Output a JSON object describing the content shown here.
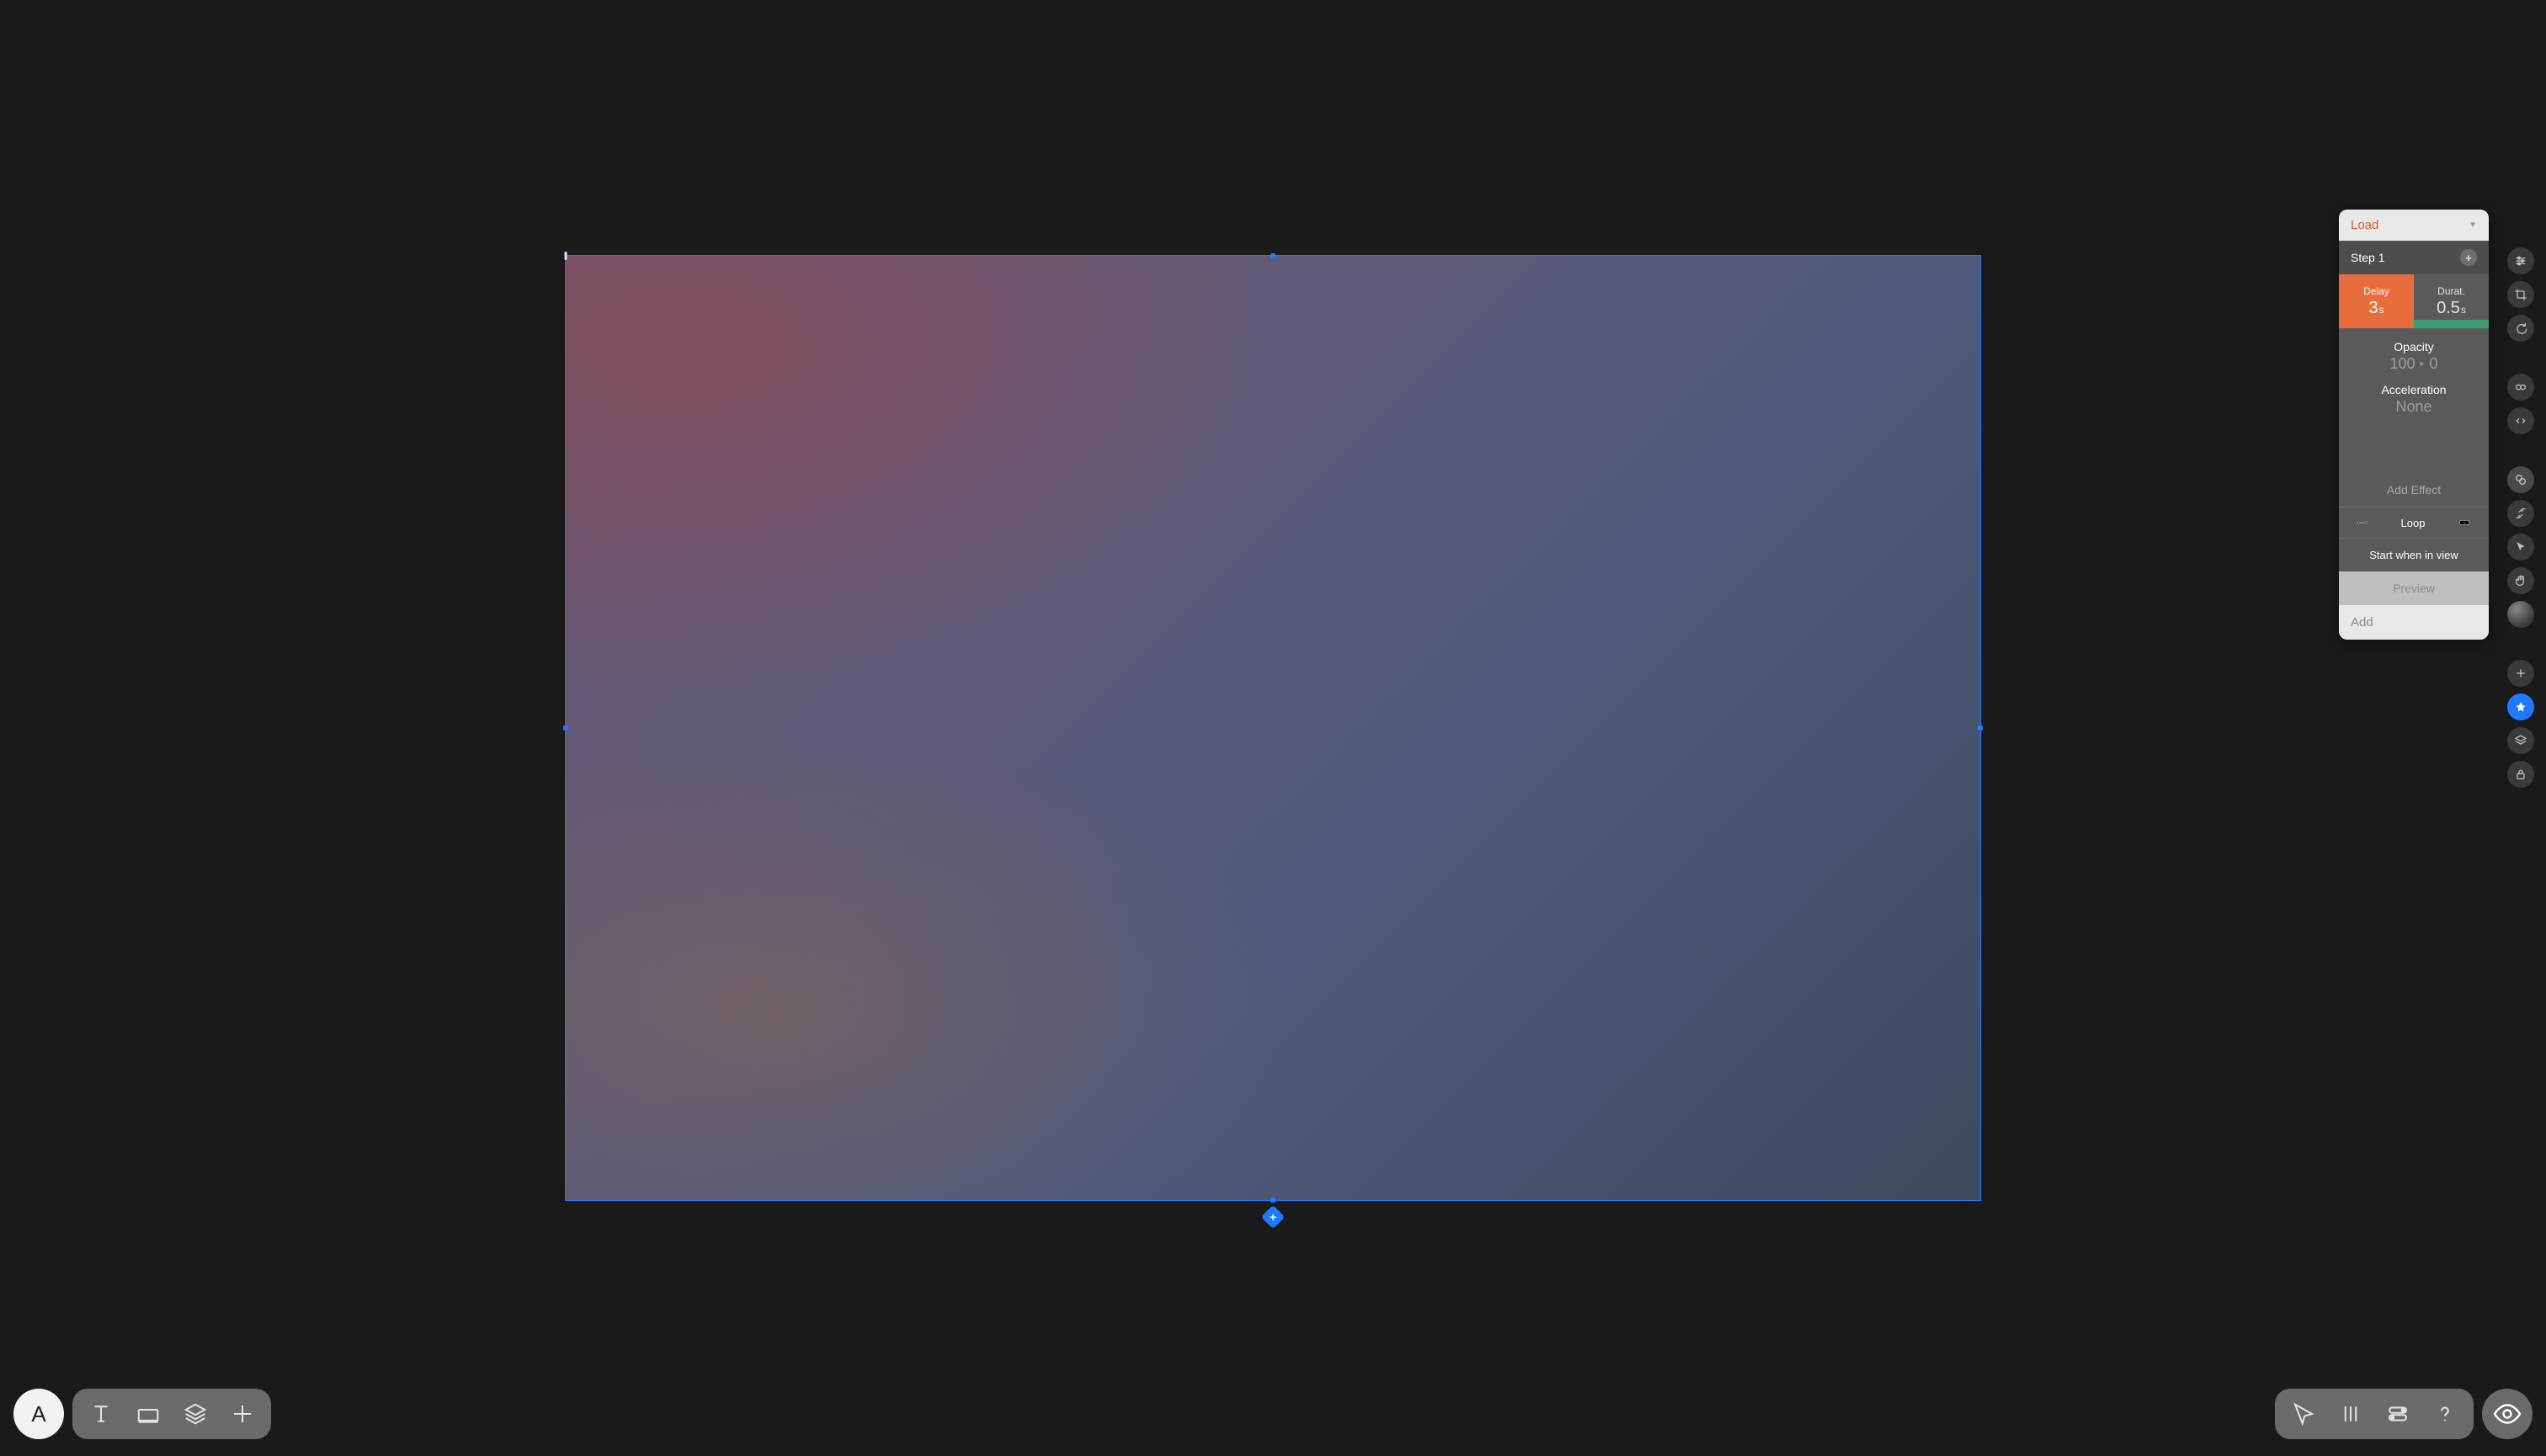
{
  "avatar_letter": "A",
  "animation_panel": {
    "trigger_label": "Load",
    "step_label": "Step 1",
    "delay": {
      "label": "Delay",
      "value": "3",
      "unit": "s"
    },
    "duration": {
      "label": "Durat.",
      "value": "0.5",
      "unit": "s"
    },
    "opacity": {
      "label": "Opacity",
      "from": "100",
      "to": "0"
    },
    "acceleration": {
      "label": "Acceleration",
      "value": "None"
    },
    "add_effect_label": "Add Effect",
    "loop_label": "Loop",
    "start_in_view_label": "Start when in view",
    "preview_label": "Preview",
    "add_label": "Add"
  }
}
